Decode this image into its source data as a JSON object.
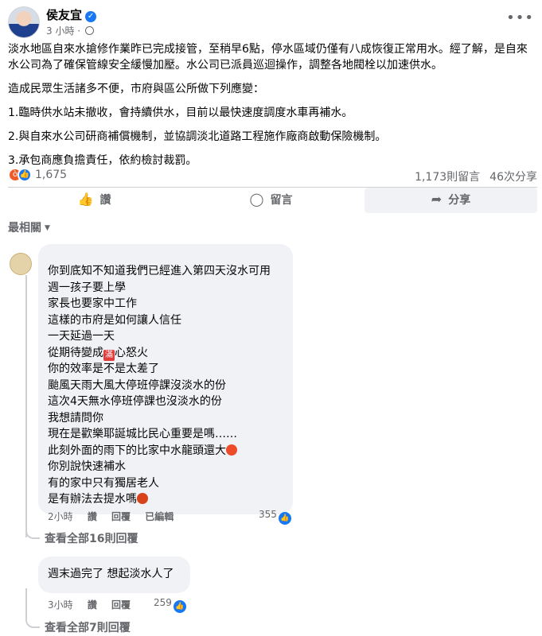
{
  "post": {
    "author": "侯友宜",
    "time": "3 小時",
    "paragraphs": [
      "淡水地區自來水搶修作業昨已完成接管，至稍早6點，停水區域仍僅有八成恢復正常用水。經了解，是自來水公司為了確保管線安全緩慢加壓。水公司已派員巡迴操作，調整各地閥栓以加速供水。",
      "造成民眾生活諸多不便，市府與區公所做下列應變：",
      "1.臨時供水站未撤收，會持續供水，目前以最快速度調度水車再補水。",
      "2.與自來水公司研商補償機制，並協調淡北道路工程施作廠商啟動保險機制。",
      "3.承包商應負擔責任，依約檢討裁罰。"
    ],
    "reaction_count": "1,675",
    "comment_count": "1,173則留言",
    "share_count": "46次分享"
  },
  "actions": {
    "like": "讚",
    "comment": "留言",
    "share": "分享"
  },
  "sort_label": "最相關",
  "comments": [
    {
      "lines": [
        "你到底知不知道我們已經進入第四天沒水可用",
        "週一孩子要上學",
        "家長也要家中工作",
        "這樣的市府是如何讓人信任",
        "一天延過一天",
        "從期待變成",
        "心怒火",
        "你的效率是不是太差了",
        "颱風天雨大風大停班停課沒淡水的份",
        "這次4天無水停班停課也沒淡水的份",
        "我想請問你",
        "現在是歡樂耶誕城比民心重要是嗎……",
        "此刻外面的雨下的比家中水龍頭還大",
        "你別說快速補水",
        "有的家中只有獨居老人",
        "是有辦法去提水嗎"
      ],
      "box_char": "滿",
      "time": "2小時",
      "like_label": "讚",
      "reply_label": "回覆",
      "edited_label": "已編輯",
      "likes": "355",
      "view_replies": "查看全部16則回覆"
    },
    {
      "text": "週末過完了 想起淡水人了",
      "time": "3小時",
      "like_label": "讚",
      "reply_label": "回覆",
      "likes": "259",
      "view_replies": "查看全部7則回覆"
    }
  ]
}
